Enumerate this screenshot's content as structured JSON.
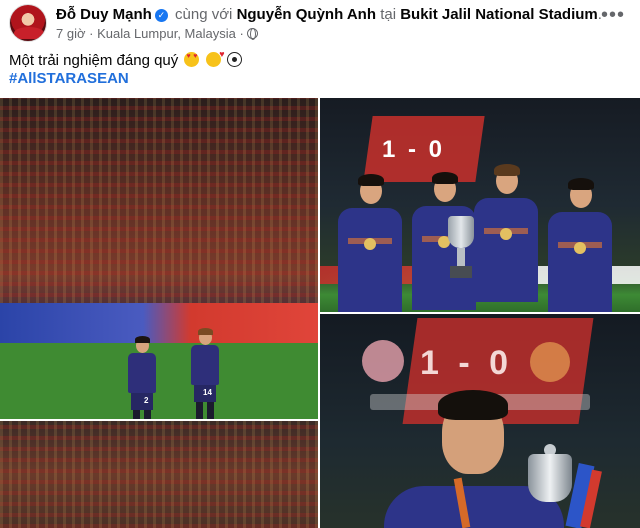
{
  "post": {
    "author": "Đỗ Duy Mạnh",
    "with_label": "cùng với",
    "tagged_person": "Nguyễn Quỳnh Anh",
    "at_label": "tại",
    "location": "Bukit Jalil National Stadium",
    "period": ".",
    "time": "7 giờ",
    "separator": "·",
    "place": "Kuala Lumpur, Malaysia",
    "separator2": "·",
    "caption": "Một trải nghiệm đáng quý",
    "hashtag": "#AllSTARASEAN",
    "more_icon_label": "•••"
  },
  "photos": {
    "scoreboard_small": "1 - 0",
    "scoreboard_big": "1 - 0",
    "player_numbers": [
      "2",
      "14"
    ]
  },
  "colors": {
    "link_blue": "#216fdb",
    "verified_blue": "#1877f2",
    "secondary_text": "#65676b"
  },
  "icons": [
    "avatar",
    "verified-badge-icon",
    "globe-icon",
    "more-options-icon",
    "heart-eyes-emoji",
    "smiling-hearts-emoji",
    "soccer-ball-emoji"
  ]
}
